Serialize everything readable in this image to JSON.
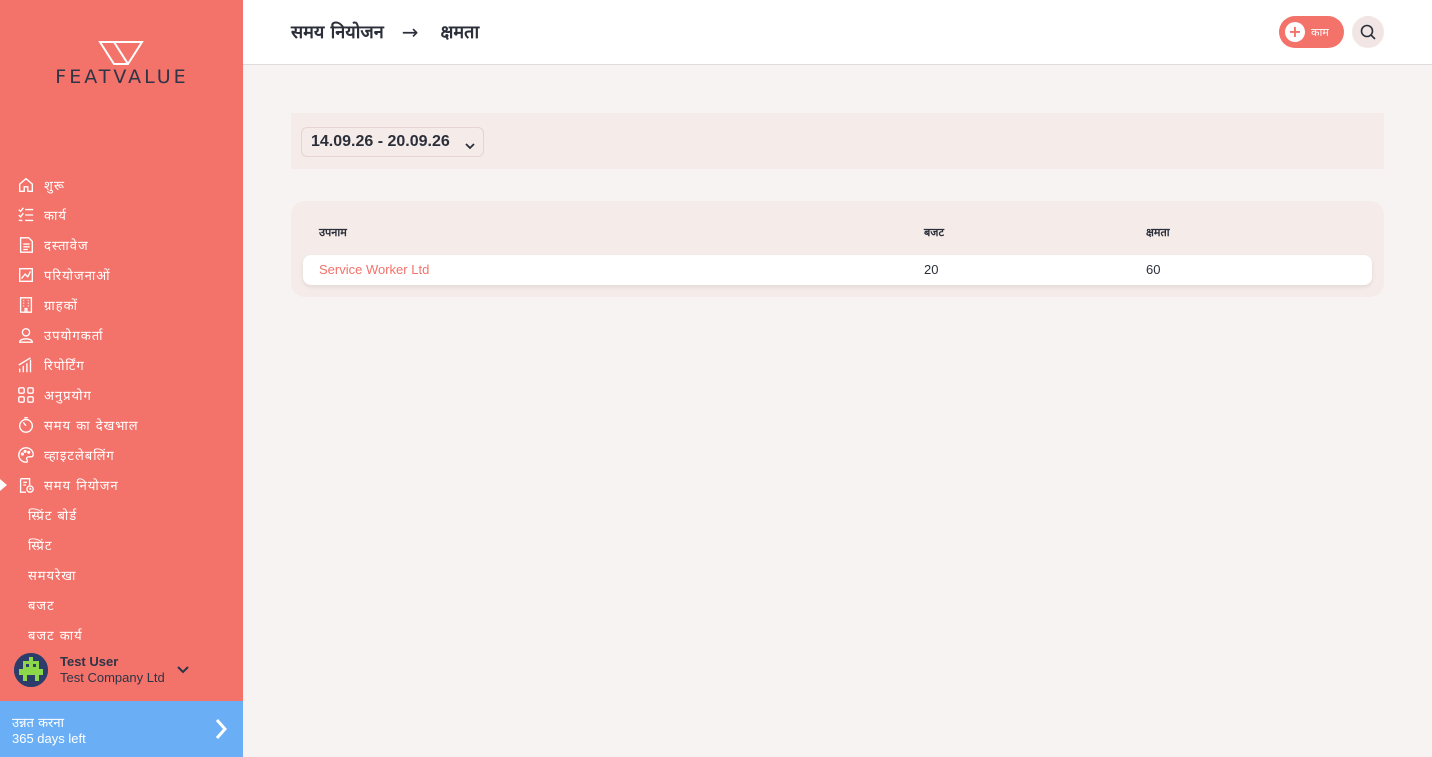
{
  "brand": {
    "name": "FEATVALUE"
  },
  "sidebar": {
    "items": [
      {
        "label": "शुरू",
        "icon": "home-icon"
      },
      {
        "label": "कार्य",
        "icon": "checklist-icon"
      },
      {
        "label": "दस्तावेज",
        "icon": "document-icon"
      },
      {
        "label": "परियोजनाओं",
        "icon": "chart-icon"
      },
      {
        "label": "ग्राहकों",
        "icon": "building-icon"
      },
      {
        "label": "उपयोगकर्ता",
        "icon": "user-icon"
      },
      {
        "label": "रिपोर्टिंग",
        "icon": "bar-chart-icon"
      },
      {
        "label": "अनुप्रयोग",
        "icon": "apps-icon"
      },
      {
        "label": "समय का देखभाल",
        "icon": "timer-icon"
      },
      {
        "label": "व्हाइटलेबलिंग",
        "icon": "palette-icon"
      },
      {
        "label": "समय नियोजन",
        "icon": "planning-icon"
      }
    ],
    "sub_items": [
      {
        "label": "स्प्रिंट बोर्ड"
      },
      {
        "label": "स्प्रिंट"
      },
      {
        "label": "समयरेखा"
      },
      {
        "label": "बजट"
      },
      {
        "label": "बजट कार्य"
      }
    ],
    "user": {
      "name": "Test User",
      "company": "Test Company Ltd"
    },
    "upgrade": {
      "title": "उन्नत करना",
      "subtitle": "365 days left"
    }
  },
  "header": {
    "breadcrumb": {
      "parent": "समय नियोजन",
      "separator": "→",
      "current": "क्षमता"
    },
    "add_label": "काम"
  },
  "filter": {
    "date_range": "14.09.26 - 20.09.26"
  },
  "table": {
    "headers": {
      "alias": "उपनाम",
      "budget": "बजट",
      "capacity": "क्षमता"
    },
    "rows": [
      {
        "alias": "Service Worker Ltd",
        "budget": "20",
        "capacity": "60"
      }
    ]
  },
  "colors": {
    "accent": "#f3726a",
    "upgrade": "#6aaef5",
    "text": "#2b2f3a"
  }
}
